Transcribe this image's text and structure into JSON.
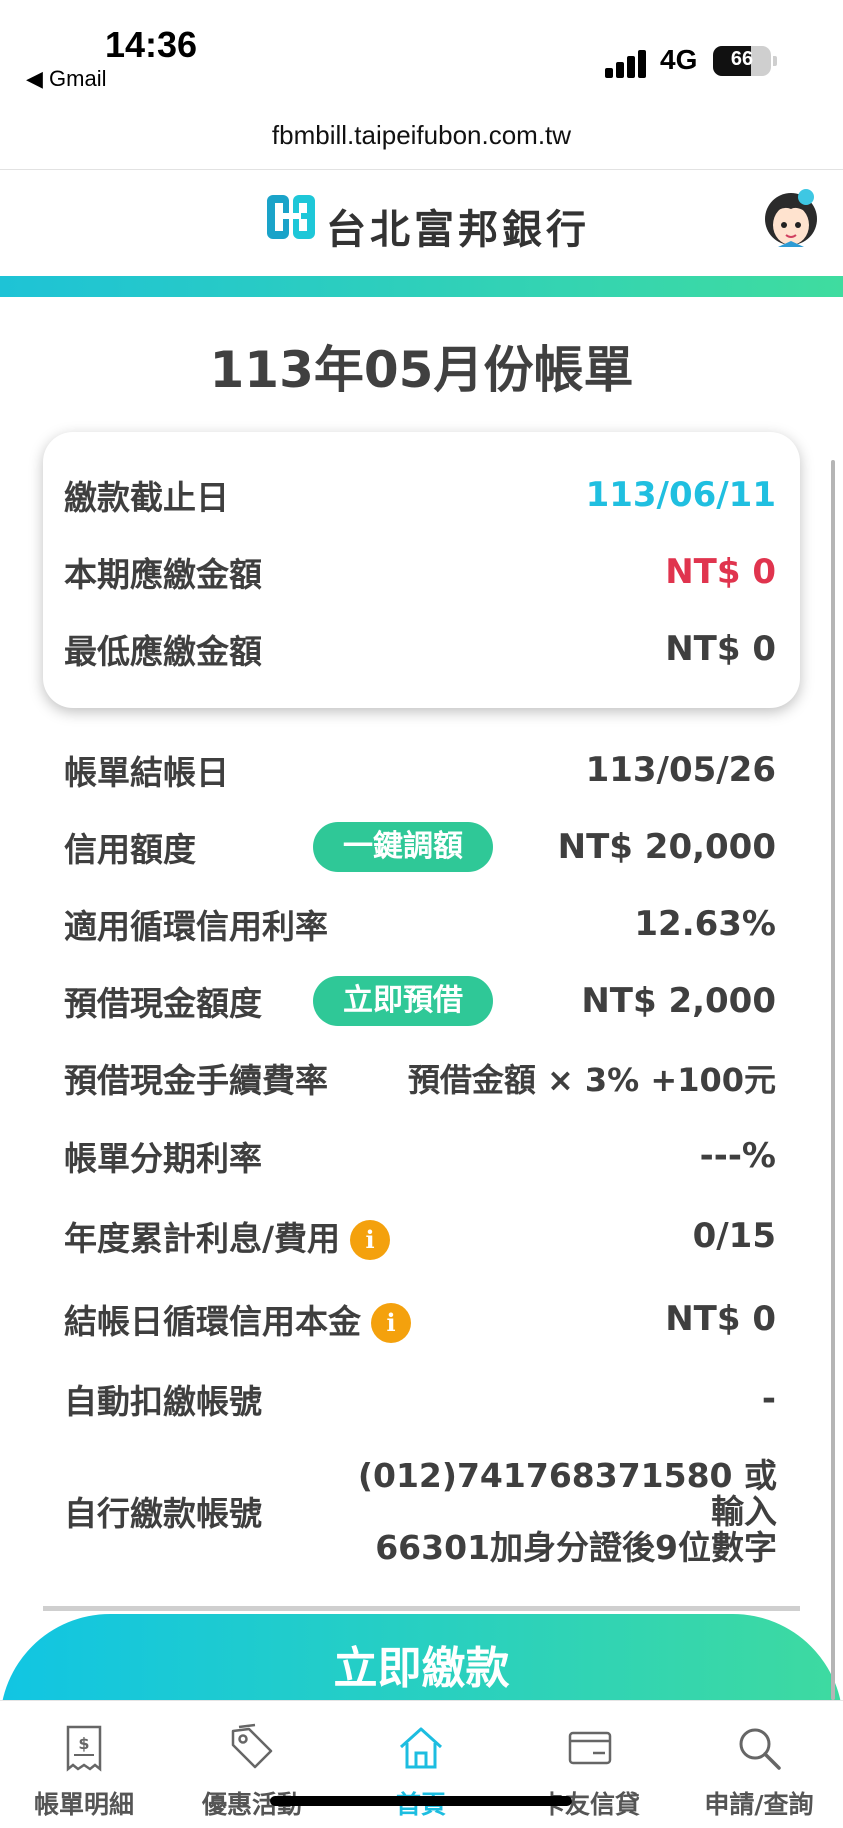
{
  "status_bar": {
    "time": "14:36",
    "back_app": "◀ Gmail",
    "network": "4G",
    "battery_percent": 66,
    "battery_label": "66"
  },
  "browser": {
    "url": "fbmbill.taipeifubon.com.tw"
  },
  "header": {
    "bank_name": "台北富邦銀行"
  },
  "title": "113年05月份帳單",
  "summary_card": {
    "due_date_label": "繳款截止日",
    "due_date_value": "113/06/11",
    "current_due_label": "本期應繳金額",
    "current_due_value": "NT$ 0",
    "min_due_label": "最低應繳金額",
    "min_due_value": "NT$ 0"
  },
  "details": {
    "closing_date_label": "帳單結帳日",
    "closing_date_value": "113/05/26",
    "credit_limit_label": "信用額度",
    "credit_limit_button": "一鍵調額",
    "credit_limit_value": "NT$ 20,000",
    "revolving_rate_label": "適用循環信用利率",
    "revolving_rate_value": "12.63%",
    "cash_advance_label": "預借現金額度",
    "cash_advance_button": "立即預借",
    "cash_advance_value": "NT$ 2,000",
    "cash_fee_label": "預借現金手續費率",
    "cash_fee_value": "預借金額 × 3% +100元",
    "installment_rate_label": "帳單分期利率",
    "installment_rate_value": "---%",
    "annual_interest_label": "年度累計利息/費用",
    "annual_interest_value": "0/15",
    "revolving_principal_label": "結帳日循環信用本金",
    "revolving_principal_value": "NT$ 0",
    "auto_debit_label": "自動扣繳帳號",
    "auto_debit_value": "-",
    "self_pay_label": "自行繳款帳號",
    "self_pay_line1": "(012)741768371580 或",
    "self_pay_line2": "輸入",
    "self_pay_line3": "66301加身分證後9位數字",
    "info_glyph": "i"
  },
  "pay_button": "立即繳款",
  "tabbar": [
    {
      "label": "帳單明細",
      "icon": "bill-icon"
    },
    {
      "label": "優惠活動",
      "icon": "tag-icon"
    },
    {
      "label": "首頁",
      "icon": "home-icon"
    },
    {
      "label": "卡友信貸",
      "icon": "card-icon"
    },
    {
      "label": "申請/查詢",
      "icon": "search-icon"
    }
  ],
  "colors": {
    "accent_blue": "#20bfe0",
    "amount_red": "#e0344e",
    "pill_green": "#2fc897",
    "info_orange": "#f4a10d"
  }
}
